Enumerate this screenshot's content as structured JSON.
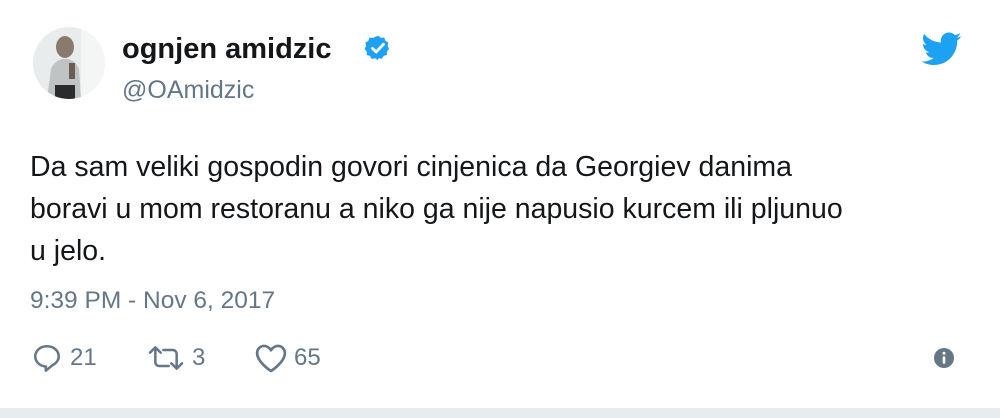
{
  "tweet": {
    "author": {
      "display_name": "ognjen amidzic",
      "handle": "@OAmidzic",
      "verified": true,
      "avatar_icon": "profile-photo"
    },
    "text_lines": [
      "Da sam veliki gospodin govori cinjenica da Georgiev danima",
      "boravi u mom restoranu a niko ga nije napusio kurcem ili pljunuo",
      "u jelo."
    ],
    "timestamp": "9:39 PM - Nov 6, 2017",
    "actions": {
      "replies": "21",
      "retweets": "3",
      "likes": "65"
    },
    "icons": {
      "brand": "twitter-bird-icon",
      "verified": "verified-badge-icon",
      "reply": "reply-icon",
      "retweet": "retweet-icon",
      "like": "heart-icon",
      "info": "info-icon"
    },
    "colors": {
      "brand_blue": "#1da1f2",
      "verified_blue": "#1da1f2",
      "text": "#14171a",
      "secondary_text": "#657786",
      "divider": "#e6ecf0"
    }
  }
}
